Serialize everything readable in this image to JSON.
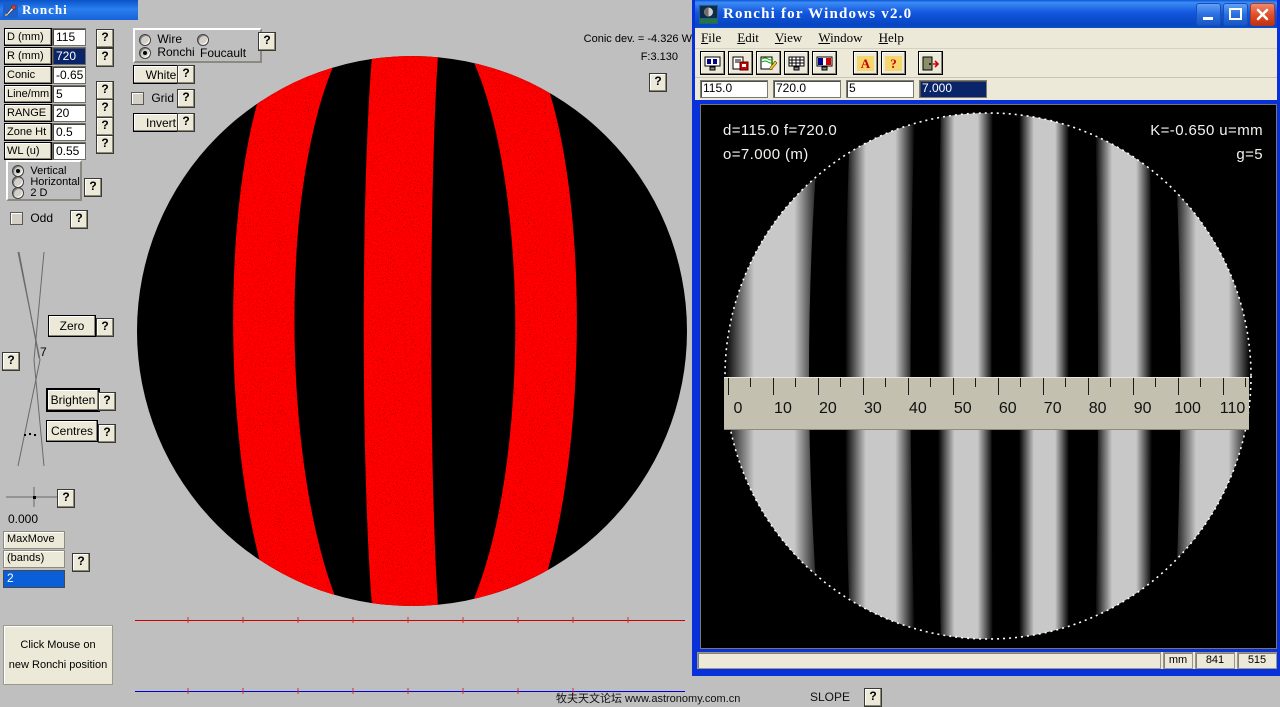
{
  "left_window": {
    "title": "Ronchi",
    "icon": "rocket-icon",
    "params": [
      {
        "label": "D   (mm)",
        "value": "115",
        "selected": false,
        "help": "?"
      },
      {
        "label": "R   (mm)",
        "value": "720",
        "selected": true,
        "help": "?"
      },
      {
        "label": "Conic",
        "value": "-0.65",
        "selected": false,
        "help": "?"
      },
      {
        "label": "Line/mm",
        "value": "5",
        "selected": false,
        "help": "?"
      },
      {
        "label": "RANGE",
        "value": "20",
        "selected": false,
        "help": "?"
      },
      {
        "label": "Zone Ht",
        "value": "0.5",
        "selected": false,
        "help": "?"
      },
      {
        "label": "WL   (u)",
        "value": "0.55",
        "selected": false,
        "help": "?"
      }
    ],
    "test_type": {
      "options": [
        "Wire",
        "Foucault",
        "Ronchi"
      ],
      "selected": "Ronchi"
    },
    "white_button": "White",
    "grid_checkbox": {
      "label": "Grid",
      "checked": false
    },
    "invert_button": "Invert",
    "orientation": {
      "options": [
        "Vertical",
        "Horizontal",
        "2 D"
      ],
      "selected": "Vertical"
    },
    "odd_checkbox": {
      "label": "Odd",
      "checked": false
    },
    "caustic_value": "7",
    "zero_button": "Zero",
    "brighten_button": "Brighten",
    "centres_button": "Centres",
    "crosshair_value": "0.000",
    "maxmove": {
      "title": "MaxMove",
      "units": "(bands)",
      "value": "2"
    },
    "hint_line1": "Click Mouse on",
    "hint_line2": "new Ronchi position",
    "conic_dev": "Conic dev. = -4.326 W",
    "focal_ratio": "F:3.130",
    "help_glyph": "?",
    "ronchigram": {
      "style": "red-on-black",
      "band_color": "#ff0000",
      "background": "#000000",
      "bands": 3
    }
  },
  "right_window": {
    "title": "Ronchi for Windows v2.0",
    "icon": "app-icon",
    "window_buttons": {
      "minimize": "_",
      "maximize": "□",
      "close": "✕"
    },
    "menu": [
      "File",
      "Edit",
      "View",
      "Window",
      "Help"
    ],
    "toolbar_icons": [
      "monitor-icon",
      "save-report-icon",
      "edit-report-icon",
      "grid-monitor-icon",
      "compare-monitor-icon",
      "letter-a-icon",
      "help-question-icon",
      "exit-door-icon"
    ],
    "value_fields": [
      {
        "value": "115.0",
        "selected": false
      },
      {
        "value": "720.0",
        "selected": false
      },
      {
        "value": "5",
        "selected": false
      },
      {
        "value": "7.000",
        "selected": true
      }
    ],
    "overlay": {
      "top_left_1": "d=115.0  f=720.0",
      "top_left_2": "o=7.000 (m)",
      "top_right_1": "K=-0.650  u=mm",
      "top_right_2": "g=5"
    },
    "ruler": {
      "labels": [
        "0",
        "10",
        "20",
        "30",
        "40",
        "50",
        "60",
        "70",
        "80",
        "90",
        "100",
        "110"
      ],
      "major_step": 10,
      "minor_step": 5,
      "max": 115
    },
    "status_bar": {
      "units": "mm",
      "x": "841",
      "y": "515"
    }
  },
  "footer": {
    "watermark": "牧夫天文论坛 www.astronomy.com.cn",
    "slope_label": "SLOPE",
    "slope_help": "?"
  },
  "colors": {
    "desktop": "#bfbfbf",
    "title_blue": "#0831d9",
    "face": "#ece9d8",
    "select_blue": "#0a246a",
    "red_band": "#ff0000",
    "plot_red": "#d00000",
    "plot_blue": "#0000d8"
  }
}
